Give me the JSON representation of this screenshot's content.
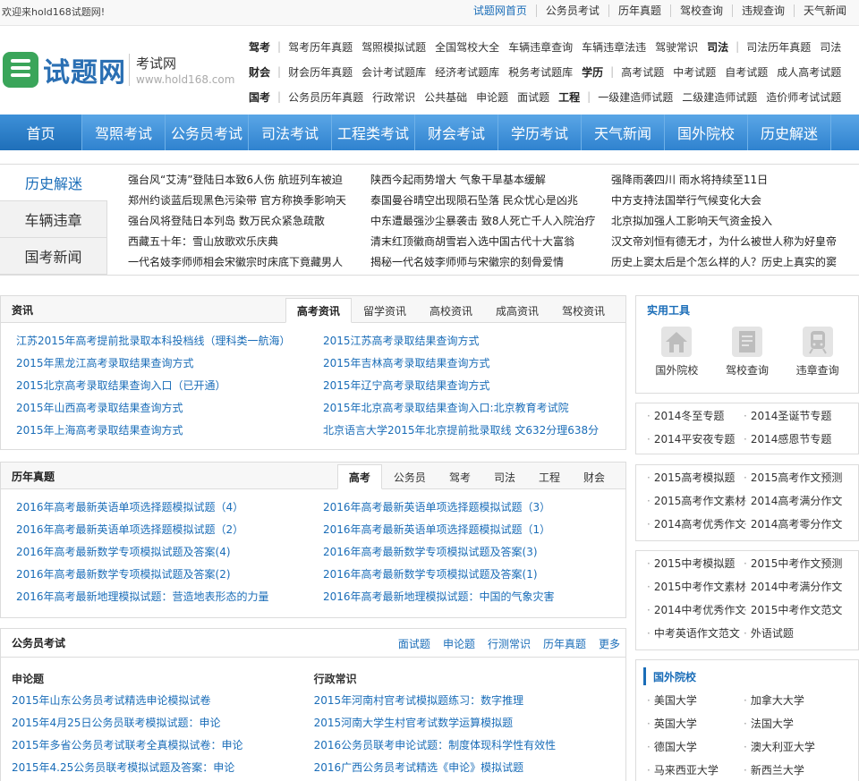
{
  "topbar": {
    "welcome": "欢迎来hold168试题网!",
    "links": [
      "试题网首页",
      "公务员考试",
      "历年真题",
      "驾校查询",
      "违规查询",
      "天气新闻"
    ]
  },
  "logo": {
    "brand": "试题网",
    "sub": "考试网",
    "url": "www.hold168.com"
  },
  "categories": [
    {
      "name": "驾考",
      "links": [
        "驾考历年真题",
        "驾照模拟试题",
        "全国驾校大全",
        "车辆违章查询",
        "车辆违章法违",
        "驾驶常识"
      ],
      "name2": "司法",
      "links2": [
        "司法历年真题",
        "司法"
      ]
    },
    {
      "name": "财会",
      "links": [
        "财会历年真题",
        "会计考试题库",
        "经济考试题库",
        "税务考试题库"
      ],
      "name2": "学历",
      "links2": [
        "高考试题",
        "中考试题",
        "自考试题",
        "成人高考试题"
      ]
    },
    {
      "name": "国考",
      "links": [
        "公务员历年真题",
        "行政常识",
        "公共基础",
        "申论题",
        "面试题"
      ],
      "name2": "工程",
      "links2": [
        "一级建造师试题",
        "二级建造师试题",
        "造价师考试试题"
      ]
    }
  ],
  "nav": [
    "首页",
    "驾照考试",
    "公务员考试",
    "司法考试",
    "工程类考试",
    "财会考试",
    "学历考试",
    "天气新闻",
    "国外院校",
    "历史解迷"
  ],
  "news": {
    "tabs": [
      "历史解迷",
      "车辆违章",
      "国考新闻"
    ],
    "col1": [
      "强台风“艾涛”登陆日本致6人伤 航班列车被迫",
      "郑州约谈蓝后现黑色污染带 官方称换季影响天",
      "强台风将登陆日本列岛 数万民众紧急疏散",
      "西藏五十年：雪山放歌欢乐庆典",
      "一代名妓李师师相会宋徽宗时床底下竟藏男人"
    ],
    "col2": [
      "陕西今起雨势增大 气象干旱基本缓解",
      "泰国曼谷晴空出现陨石坠落 民众忧心是凶兆",
      "中东遭最强沙尘暴袭击 致8人死亡千人入院治疗",
      "清末红顶徽商胡雪岩入选中国古代十大富翁",
      "揭秘一代名妓李师师与宋徽宗的刻骨爱情"
    ],
    "col3": [
      "强降雨袭四川 雨水将持续至11日",
      "中方支持法国举行气候变化大会",
      "北京拟加强人工影响天气资金投入",
      "汉文帝刘恒有德无才，为什么被世人称为好皇帝",
      "历史上窦太后是个怎么样的人？历史上真实的窦"
    ]
  },
  "zixun": {
    "title": "资讯",
    "tabs": [
      "高考资讯",
      "留学资讯",
      "高校资讯",
      "成高资讯",
      "驾校资讯"
    ],
    "items": [
      "江苏2015年高考提前批录取本科投档线（理科类一航海）",
      "2015江苏高考录取结果查询方式",
      "2015年黑龙江高考录取结果查询方式",
      "2015年吉林高考录取结果查询方式",
      "2015北京高考录取结果查询入口（已开通）",
      "2015年辽宁高考录取结果查询方式",
      "2015年山西高考录取结果查询方式",
      "2015年北京高考录取结果查询入口:北京教育考试院",
      "2015年上海高考录取结果查询方式",
      "北京语言大学2015年北京提前批录取线 文632分理638分"
    ]
  },
  "zhenti": {
    "title": "历年真题",
    "tabs": [
      "高考",
      "公务员",
      "驾考",
      "司法",
      "工程",
      "财会"
    ],
    "items": [
      "2016年高考最新英语单项选择题模拟试题（4）",
      "2016年高考最新英语单项选择题模拟试题（3）",
      "2016年高考最新英语单项选择题模拟试题（2）",
      "2016年高考最新英语单项选择题模拟试题（1）",
      "2016年高考最新数学专项模拟试题及答案(4)",
      "2016年高考最新数学专项模拟试题及答案(3)",
      "2016年高考最新数学专项模拟试题及答案(2)",
      "2016年高考最新数学专项模拟试题及答案(1)",
      "2016年高考最新地理模拟试题：营造地表形态的力量",
      "2016年高考最新地理模拟试题：中国的气象灾害"
    ]
  },
  "gwy": {
    "title": "公务员考试",
    "links": [
      "面试题",
      "申论题",
      "行测常识",
      "历年真题",
      "更多"
    ],
    "col1_head": "申论题",
    "col1": [
      "2015年山东公务员考试精选申论模拟试卷",
      "2015年4月25日公务员联考模拟试题：申论",
      "2015年多省公务员考试联考全真模拟试卷：申论",
      "2015年4.25公务员联考模拟试题及答案：申论"
    ],
    "col2_head": "行政常识",
    "col2": [
      "2015年河南村官考试模拟题练习：数字推理",
      "2015河南大学生村官考试数学运算模拟题",
      "2016公务员联考申论试题：制度体现科学性有效性",
      "2016广西公务员考试精选《申论》模拟试题"
    ]
  },
  "tools": {
    "title": "实用工具",
    "items": [
      {
        "label": "国外院校",
        "icon": "house-icon"
      },
      {
        "label": "驾校查询",
        "icon": "document-icon"
      },
      {
        "label": "违章查询",
        "icon": "train-icon"
      }
    ]
  },
  "topics1": [
    "2014冬至专题",
    "2014圣诞节专题",
    "2014平安夜专题",
    "2014感恩节专题"
  ],
  "topics2": [
    "2015高考模拟题",
    "2015高考作文预测",
    "2015高考作文素材",
    "2014高考满分作文",
    "2014高考优秀作文",
    "2014高考零分作文"
  ],
  "topics3": [
    "2015中考模拟题",
    "2015中考作文预测",
    "2015中考作文素材",
    "2014中考满分作文",
    "2014中考优秀作文",
    "2015中考作文范文",
    "中考英语作文范文",
    "外语试题"
  ],
  "schools": {
    "title": "国外院校",
    "items": [
      "美国大学",
      "加拿大大学",
      "英国大学",
      "法国大学",
      "德国大学",
      "澳大利亚大学",
      "马来西亚大学",
      "新西兰大学"
    ]
  }
}
